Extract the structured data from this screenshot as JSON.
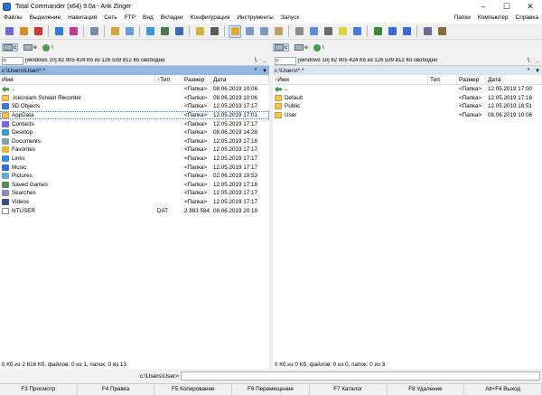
{
  "window": {
    "title": "Total Commander (x64) 9.0a - Arik Zinger",
    "minimize": "–",
    "maximize": "☐",
    "close": "✕"
  },
  "menu": {
    "left": [
      "Файлы",
      "Выделение",
      "Навигация",
      "Сеть",
      "FTP",
      "Вид",
      "Вкладки",
      "Конфигурация",
      "Инструменты",
      "Запуск"
    ],
    "right": [
      "Папки",
      "Компьютер",
      "Справка"
    ]
  },
  "toolbar": {
    "buttons": [
      {
        "icon": "gear-icon",
        "color": "#6b6bd6"
      },
      {
        "icon": "gear-double-icon",
        "color": "#d68b2c"
      },
      {
        "icon": "gear-red-icon",
        "color": "#c83a3a"
      },
      {
        "sep": true
      },
      {
        "icon": "refresh-icon",
        "color": "#2b7bd8"
      },
      {
        "icon": "sync-icon",
        "color": "#c03a8f"
      },
      {
        "sep": true
      },
      {
        "icon": "search-icon",
        "color": "#7a8aa0"
      },
      {
        "sep": true
      },
      {
        "icon": "pack-icon",
        "color": "#d8a23a"
      },
      {
        "icon": "unpack-icon",
        "color": "#6a9ad8"
      },
      {
        "sep": true
      },
      {
        "icon": "star-icon",
        "color": "#3a9ad8"
      },
      {
        "icon": "network-icon",
        "color": "#4a7a4a"
      },
      {
        "icon": "ftp-icon",
        "color": "#3a6ab8"
      },
      {
        "sep": true
      },
      {
        "icon": "folder-tree-icon",
        "color": "#d8b23a"
      },
      {
        "icon": "plugin-icon",
        "color": "#5a5a5a"
      },
      {
        "sep": true
      },
      {
        "icon": "brief-view-icon",
        "color": "#e0a832",
        "active": true
      },
      {
        "icon": "full-view-icon",
        "color": "#7a9ac0"
      },
      {
        "icon": "tree-view-icon",
        "color": "#7a9ac0"
      },
      {
        "icon": "thumbs-view-icon",
        "color": "#c0a060"
      },
      {
        "sep": true
      },
      {
        "icon": "filter-icon",
        "color": "#8a8a8a"
      },
      {
        "icon": "copy-names-icon",
        "color": "#5a8ad8"
      },
      {
        "icon": "notepad-icon",
        "color": "#6a6a6a"
      },
      {
        "icon": "docs-icon",
        "color": "#d8d83a"
      },
      {
        "icon": "list-icon",
        "color": "#4a7ad8"
      },
      {
        "sep": true
      },
      {
        "icon": "disk-icon",
        "color": "#3a8a3a"
      },
      {
        "icon": "compare-icon",
        "color": "#3a6ad8"
      },
      {
        "icon": "split-icon",
        "color": "#3a6ad8"
      },
      {
        "sep": true
      },
      {
        "icon": "tools-icon",
        "color": "#6a6aa0"
      },
      {
        "icon": "settings-icon",
        "color": "#8a6a3a"
      }
    ]
  },
  "left": {
    "drives": [
      {
        "label": "c",
        "selected": true
      },
      {
        "label": "e",
        "selected": false
      }
    ],
    "net_label": "\\",
    "combo": "c",
    "free_text": "[windows 10]  82 905 424 Кб из 126 539 812 Кб свободно",
    "root_btn": "\\",
    "up_btn": "..",
    "path": "c:\\Users\\User\\*.*",
    "path_star": "*",
    "path_arrow": "▾",
    "columns": {
      "name": "Имя",
      "type": "↑Тип",
      "size": "Размер",
      "date": "Дата"
    },
    "rows": [
      {
        "name": "..",
        "type": "",
        "size": "<Папка>",
        "date": "08.06.2019 10:06",
        "kind": "up"
      },
      {
        "name": ".Icecream Screen Recorder",
        "type": "",
        "size": "<Папка>",
        "date": "08.06.2019 10:06",
        "kind": "folder"
      },
      {
        "name": "3D Objects",
        "type": "",
        "size": "<Папка>",
        "date": "12.05.2019 17:17",
        "kind": "folder",
        "icolor": "#3a7ad8"
      },
      {
        "name": "AppData",
        "type": "",
        "size": "<Папка>",
        "date": "12.05.2019 17:01",
        "kind": "folder",
        "cursor": true
      },
      {
        "name": "Contacts",
        "type": "",
        "size": "<Папка>",
        "date": "12.05.2019 17:17",
        "kind": "folder",
        "icolor": "#7a6ad8"
      },
      {
        "name": "Desktop",
        "type": "",
        "size": "<Папка>",
        "date": "08.06.2019 14:28",
        "kind": "folder",
        "icolor": "#3a9ad8"
      },
      {
        "name": "Documents",
        "type": "",
        "size": "<Папка>",
        "date": "12.05.2019 17:18",
        "kind": "folder",
        "icolor": "#8a9ab0"
      },
      {
        "name": "Favorites",
        "type": "",
        "size": "<Папка>",
        "date": "12.05.2019 17:17",
        "kind": "folder",
        "icolor": "#e0b83a"
      },
      {
        "name": "Links",
        "type": "",
        "size": "<Папка>",
        "date": "12.05.2019 17:17",
        "kind": "folder",
        "icolor": "#3a8ad8"
      },
      {
        "name": "Music",
        "type": "",
        "size": "<Папка>",
        "date": "12.05.2019 17:17",
        "kind": "folder",
        "icolor": "#3a6ad8"
      },
      {
        "name": "Pictures",
        "type": "",
        "size": "<Папка>",
        "date": "02.06.2019 19:53",
        "kind": "folder",
        "icolor": "#6aaad8"
      },
      {
        "name": "Saved Games",
        "type": "",
        "size": "<Папка>",
        "date": "12.05.2019 17:18",
        "kind": "folder",
        "icolor": "#5a8a5a"
      },
      {
        "name": "Searches",
        "type": "",
        "size": "<Папка>",
        "date": "12.05.2019 17:17",
        "kind": "folder",
        "icolor": "#8a8ab8"
      },
      {
        "name": "Videos",
        "type": "",
        "size": "<Папка>",
        "date": "12.05.2019 17:17",
        "kind": "folder",
        "icolor": "#3a4a8a"
      },
      {
        "name": "NTUSER",
        "type": "DAT",
        "size": "2 883 584",
        "date": "08.06.2019 20:19",
        "kind": "file"
      }
    ],
    "status": "0 Кб из 2 816 Кб, файлов: 0 из 1, папок: 0 из 13"
  },
  "right": {
    "drives": [
      {
        "label": "c",
        "selected": true
      },
      {
        "label": "e",
        "selected": false
      }
    ],
    "net_label": "\\",
    "combo": "c",
    "free_text": "[windows 10]  82 905 424 Кб из 126 539 812 Кб свободно",
    "root_btn": "\\",
    "up_btn": "..",
    "path": "c:\\Users\\*.*",
    "path_star": "*",
    "path_arrow": "▾",
    "columns": {
      "name": "↑Имя",
      "type": "Тип",
      "size": "Размер",
      "date": "Дата"
    },
    "rows": [
      {
        "name": "..",
        "type": "",
        "size": "<Папка>",
        "date": "12.05.2019 17:00",
        "kind": "up"
      },
      {
        "name": "Default",
        "type": "",
        "size": "<Папка>",
        "date": "12.05.2019 17:16",
        "kind": "folder"
      },
      {
        "name": "Public",
        "type": "",
        "size": "<Папка>",
        "date": "12.05.2019 18:51",
        "kind": "folder"
      },
      {
        "name": "User",
        "type": "",
        "size": "<Папка>",
        "date": "08.06.2019 10:06",
        "kind": "folder"
      }
    ],
    "status": "0 Кб из 0 Кб, файлов: 0 из 0, папок: 0 из 3"
  },
  "cmdline": {
    "label": "c:\\Users\\User>",
    "value": ""
  },
  "fkeys": [
    "F3 Просмотр",
    "F4 Правка",
    "F5 Копирование",
    "F6 Перемещение",
    "F7 Каталог",
    "F8 Удаление",
    "Alt+F4 Выход"
  ]
}
